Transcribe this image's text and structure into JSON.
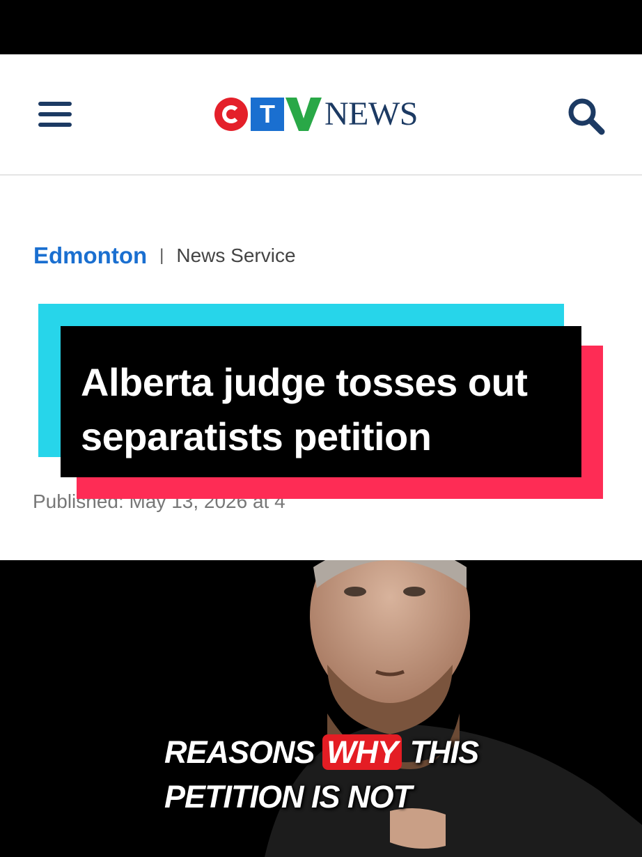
{
  "header": {
    "menu_icon": "hamburger-menu-icon",
    "logo_text": "CTV",
    "logo_news": "NEWS",
    "search_icon": "search-icon",
    "colors": {
      "brand_red": "#e4202a",
      "brand_blue": "#1a6fd0",
      "navy": "#1c3a63"
    }
  },
  "article": {
    "section": "Edmonton",
    "separator": "|",
    "source": "News Service",
    "published": "Publisned: May 13, 2026 at 4"
  },
  "overlay": {
    "headline_line1": "Alberta judge tosses out",
    "headline_line2": "separatists petition",
    "colors": {
      "cyan": "#27d5ea",
      "red": "#fe2c55"
    }
  },
  "captions": {
    "line1_before": "REASONS",
    "line1_highlight": "WHY",
    "line1_after": "THIS",
    "line2": "PETITION IS NOT"
  }
}
